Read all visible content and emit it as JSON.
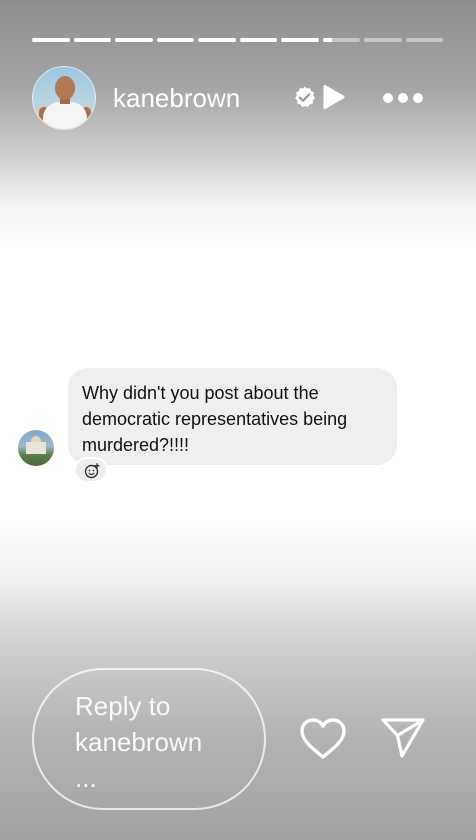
{
  "story": {
    "progress": {
      "segments": 10,
      "completed": 7,
      "current_fraction": 0.25
    },
    "header": {
      "username": "kanebrown",
      "verified": true,
      "icons": {
        "verified": "verified-badge-icon",
        "play": "play-icon",
        "more": "more-options-icon"
      }
    },
    "comment": {
      "text": "Why didn't you post about the democratic representatives being murdered?!!!!",
      "reaction_icon": "add-reaction-icon"
    },
    "reply": {
      "placeholder": "Reply to kanebrown ...",
      "icons": {
        "like": "heart-icon",
        "send": "send-icon"
      }
    }
  },
  "colors": {
    "white": "#ffffff",
    "bubble": "#efefef",
    "text": "#111111"
  }
}
